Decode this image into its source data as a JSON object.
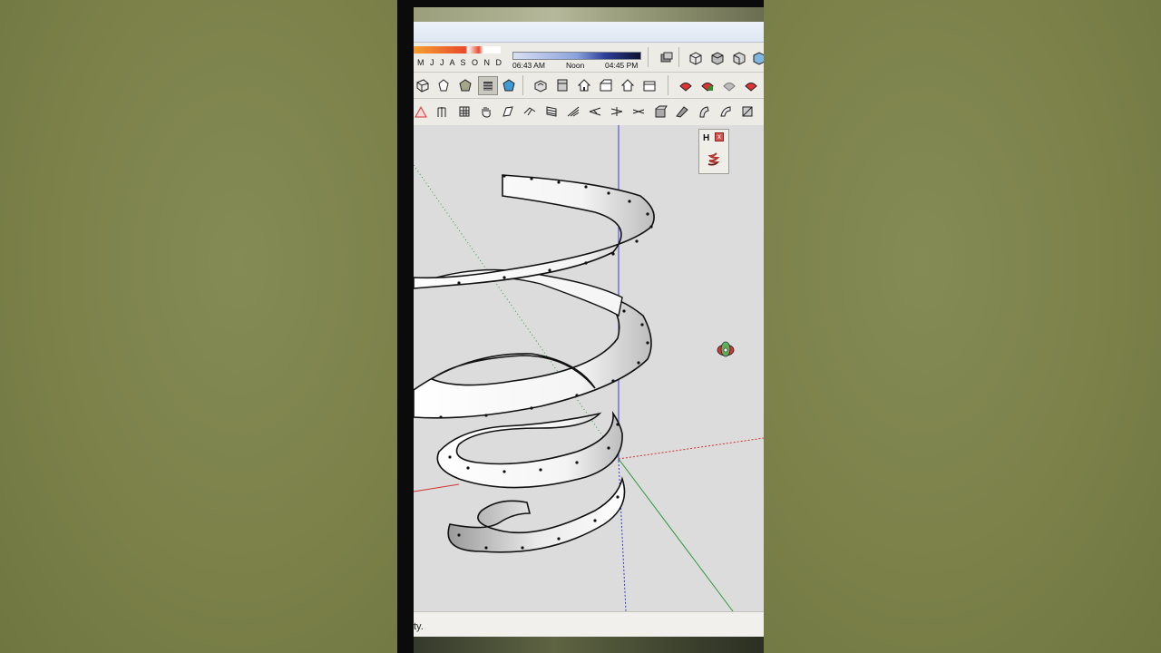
{
  "shadow_settings": {
    "months": "M J J A S O N D",
    "time_start": "06:43 AM",
    "time_mid": "Noon",
    "time_end": "04:45 PM"
  },
  "floating_toolbar": {
    "title": "H",
    "close_label": "x"
  },
  "status": {
    "text": "ty."
  },
  "colors": {
    "axis_red": "#d23232",
    "axis_green": "#2e9a3a",
    "axis_blue": "#3a3ad0",
    "viewport_bg": "#dcdcdc"
  }
}
